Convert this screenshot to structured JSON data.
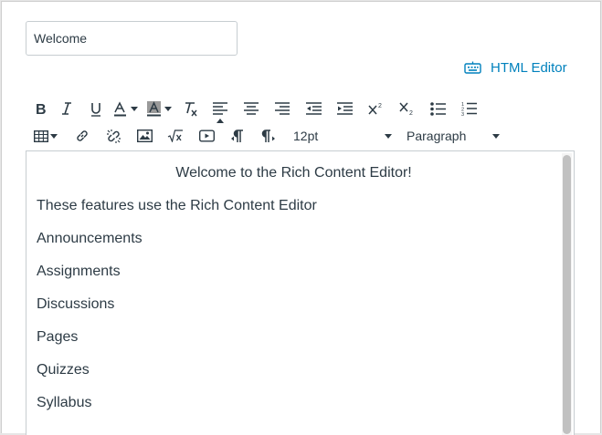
{
  "title_input": {
    "value": "Welcome"
  },
  "html_editor": {
    "icon": "keyboard-icon",
    "label": "HTML Editor",
    "color": "#0081bd"
  },
  "toolbar": {
    "font_size": "12pt",
    "block_format": "Paragraph"
  },
  "editor": {
    "heading": "Welcome to the Rich Content Editor!",
    "paragraphs": [
      "These features use the Rich Content Editor",
      "Announcements",
      "Assignments",
      "Discussions",
      "Pages",
      "Quizzes",
      "Syllabus"
    ]
  },
  "colors": {
    "text": "#2d3b45",
    "link": "#0081bd",
    "border": "#c7cdd1"
  }
}
